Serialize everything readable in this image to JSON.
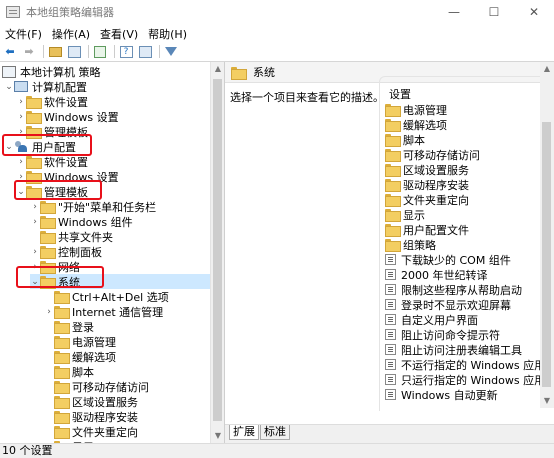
{
  "window": {
    "title": "本地组策略编辑器",
    "minimize": "—",
    "maximize": "☐",
    "close": "✕"
  },
  "menu": [
    "文件(F)",
    "操作(A)",
    "查看(V)",
    "帮助(H)"
  ],
  "tree": {
    "root": "本地计算机 策略",
    "computer_config": "计算机配置",
    "computer_children": [
      "软件设置",
      "Windows 设置",
      "管理模板"
    ],
    "user_config": "用户配置",
    "user_children": [
      "软件设置",
      "Windows 设置"
    ],
    "admin_templates": "管理模板",
    "admin_children": [
      "\"开始\"菜单和任务栏",
      "Windows 组件",
      "共享文件夹",
      "控制面板",
      "网络"
    ],
    "system": "系统",
    "system_children": [
      "Ctrl+Alt+Del 选项",
      "Internet 通信管理",
      "登录",
      "电源管理",
      "缓解选项",
      "脚本",
      "可移动存储访问",
      "区域设置服务",
      "驱动程序安装",
      "文件夹重定向",
      "显示"
    ]
  },
  "right": {
    "header_title": "系统",
    "description": "选择一个项目来查看它的描述。",
    "column_header": "设置",
    "folders": [
      "电源管理",
      "缓解选项",
      "脚本",
      "可移动存储访问",
      "区域设置服务",
      "驱动程序安装",
      "文件夹重定向",
      "显示",
      "用户配置文件",
      "组策略"
    ],
    "policies": [
      "下载缺少的 COM 组件",
      "2000 年世纪转译",
      "限制这些程序从帮助启动",
      "登录时不显示欢迎屏幕",
      "自定义用户界面",
      "阻止访问命令提示符",
      "阻止访问注册表编辑工具",
      "不运行指定的 Windows 应用程序",
      "只运行指定的 Windows 应用程序",
      "Windows 自动更新"
    ]
  },
  "tabs": [
    "扩展",
    "标准"
  ],
  "status": "10 个设置",
  "colors": {
    "highlight": "#e8101a",
    "folder": "#f3ce62"
  }
}
